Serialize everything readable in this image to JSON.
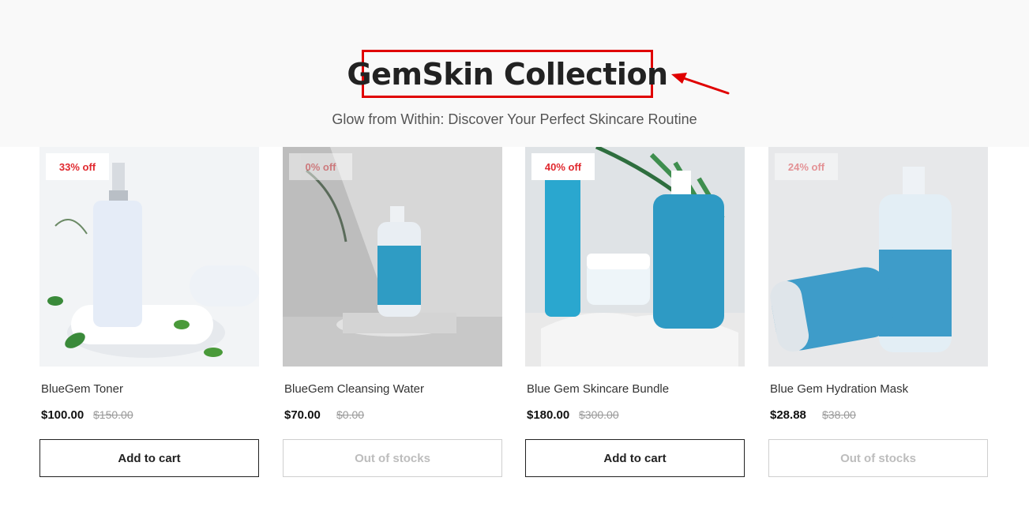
{
  "header": {
    "title": "GemSkin Collection",
    "subtitle": "Glow from Within: Discover Your Perfect Skincare Routine"
  },
  "colors": {
    "highlight_box": "#e00000",
    "badge_text": "#e0282e",
    "product_blue": "#2f9cc4"
  },
  "products": [
    {
      "badge": "33% off",
      "name": "BlueGem Toner",
      "price": "$100.00",
      "compare_price": "$150.00",
      "button": "Add to cart",
      "in_stock": true
    },
    {
      "badge": "0% off",
      "name": "BlueGem Cleansing Water",
      "price": "$70.00",
      "compare_price": "$0.00",
      "button": "Out of stocks",
      "in_stock": false
    },
    {
      "badge": "40% off",
      "name": "Blue Gem Skincare Bundle",
      "price": "$180.00",
      "compare_price": "$300.00",
      "button": "Add to cart",
      "in_stock": true
    },
    {
      "badge": "24% off",
      "name": "Blue Gem Hydration Mask",
      "price": "$28.88",
      "compare_price": "$38.00",
      "button": "Out of stocks",
      "in_stock": false
    }
  ]
}
